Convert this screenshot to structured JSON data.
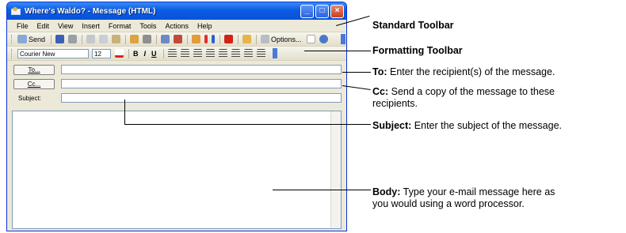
{
  "window": {
    "title": "Where's Waldo? - Message (HTML)",
    "controls": [
      "_",
      "□",
      "×"
    ]
  },
  "menubar": [
    "File",
    "Edit",
    "View",
    "Insert",
    "Format",
    "Tools",
    "Actions",
    "Help"
  ],
  "standard_toolbar": {
    "send_label": "Send",
    "options_label": "Options...",
    "icons": [
      "save-icon",
      "print-icon",
      "cut-icon",
      "copy-icon",
      "paste-icon",
      "attach-icon",
      "insert-file-icon",
      "address-book-icon",
      "check-names-icon",
      "signature-icon",
      "high-importance-icon",
      "low-importance-icon",
      "flag-icon",
      "envelope-icon"
    ]
  },
  "formatting_toolbar": {
    "font": "Courier New",
    "size": "12",
    "buttons": [
      "B",
      "I",
      "U"
    ],
    "icons": [
      "font-color-icon",
      "align-left-icon",
      "center-icon",
      "align-right-icon",
      "bullets-icon",
      "numbering-icon",
      "decrease-indent-icon",
      "increase-indent-icon",
      "horizontal-line-icon"
    ]
  },
  "fields": {
    "to_button": "To...",
    "cc_button": "Cc...",
    "subject_label": "Subject:"
  },
  "callouts": {
    "standard_toolbar": "Standard Toolbar",
    "formatting_toolbar": "Formatting Toolbar",
    "to_title": "To:",
    "to_text": " Enter the recipient(s) of the message.",
    "cc_title": "Cc:",
    "cc_text_1": " Send a copy of the message to these",
    "cc_text_2": "recipients.",
    "subject_title": "Subject:",
    "subject_text": " Enter the subject of the message.",
    "body_title": "Body:",
    "body_text_1": " Type your e-mail message here as",
    "body_text_2": "you would using a word processor."
  }
}
